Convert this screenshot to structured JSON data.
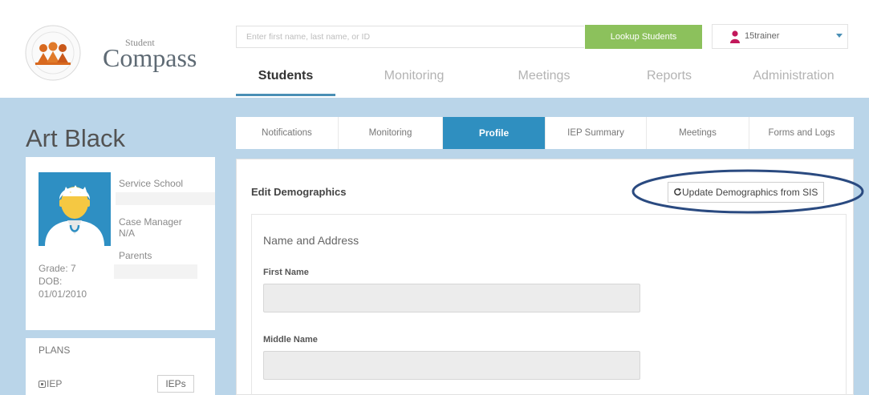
{
  "brand": {
    "logo_small": "Student",
    "logo_large": "Compass"
  },
  "search": {
    "placeholder": "Enter first name, last name, or ID",
    "value": "",
    "button_label": "Lookup Students"
  },
  "user": {
    "name": "15trainer",
    "icon": "user-icon",
    "icon_color": "#c2185b"
  },
  "main_nav": {
    "items": [
      {
        "label": "Students",
        "active": true
      },
      {
        "label": "Monitoring",
        "active": false
      },
      {
        "label": "Meetings",
        "active": false
      },
      {
        "label": "Reports",
        "active": false
      },
      {
        "label": "Administration",
        "active": false
      }
    ],
    "accent_color": "#4a8fb5"
  },
  "student": {
    "name": "Art Black",
    "service_school_label": "Service School",
    "case_manager_label": "Case Manager",
    "case_manager_value": "N/A",
    "parents_label": "Parents",
    "grade": "Grade: 7",
    "dob_label": "DOB:",
    "dob_value": "01/01/2010"
  },
  "plans": {
    "label": "PLANS",
    "items": [
      {
        "label": "IEP",
        "button": "IEPs"
      }
    ]
  },
  "sub_tabs": {
    "items": [
      {
        "label": "Notifications",
        "active": false
      },
      {
        "label": "Monitoring",
        "active": false
      },
      {
        "label": "Profile",
        "active": true
      },
      {
        "label": "IEP Summary",
        "active": false
      },
      {
        "label": "Meetings",
        "active": false
      },
      {
        "label": "Forms and Logs",
        "active": false
      }
    ],
    "active_color": "#2f8fc0"
  },
  "panel": {
    "title": "Edit Demographics",
    "update_button": "Update Demographics from SIS",
    "section_title": "Name and Address",
    "fields": [
      {
        "label": "First Name",
        "value": ""
      },
      {
        "label": "Middle Name",
        "value": ""
      }
    ]
  },
  "colors": {
    "band": "#bad5e9",
    "lookup_button": "#8cc15c",
    "annotation_ellipse": "#2a4a80"
  }
}
